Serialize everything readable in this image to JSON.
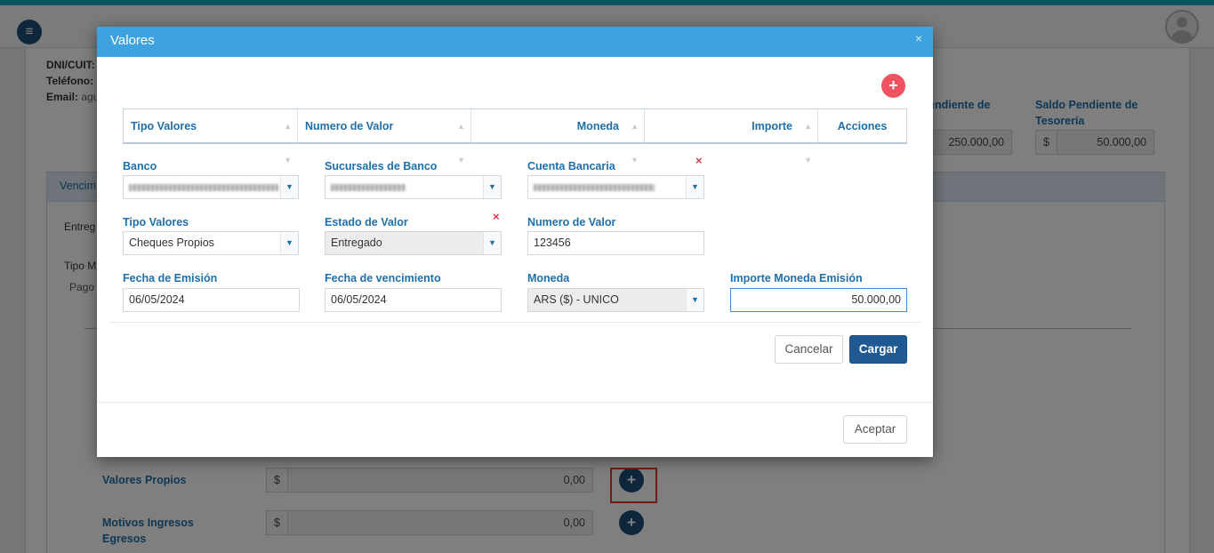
{
  "background": {
    "customer": {
      "dni_label": "DNI/CUIT:",
      "phone_label": "Teléfono:",
      "email_label": "Email:",
      "email_partial": "agu"
    },
    "balances": {
      "pending_label": "endiente de",
      "pending_value": "250.000,00",
      "treasury_label_1": "Saldo Pendiente de",
      "treasury_label_2": "Tesorería",
      "treasury_currency": "$",
      "treasury_value": "50.000,00"
    },
    "tab_partial": "Vencim",
    "entreg_partial": "Entreg",
    "tipo_partial": "Tipo M",
    "pago_partial": "Pago",
    "valores_propios": {
      "label": "Valores Propios",
      "currency": "$",
      "value": "0,00"
    },
    "motivos": {
      "label_1": "Motivos Ingresos",
      "label_2": "Egresos",
      "currency": "$",
      "value": "0,00"
    }
  },
  "modal": {
    "title": "Valores",
    "close_glyph": "×",
    "add_glyph": "+",
    "grid_columns": [
      "Tipo Valores",
      "Numero de Valor",
      "Moneda",
      "Importe",
      "Acciones"
    ],
    "fields": {
      "banco": {
        "label": "Banco"
      },
      "sucursal": {
        "label": "Sucursales de Banco"
      },
      "cuenta": {
        "label": "Cuenta Bancaria"
      },
      "tipo_valores": {
        "label": "Tipo Valores",
        "value": "Cheques Propios"
      },
      "estado": {
        "label": "Estado de Valor",
        "value": "Entregado"
      },
      "numero": {
        "label": "Numero de Valor",
        "value": "123456"
      },
      "fecha_emision": {
        "label": "Fecha de Emisión",
        "value": "06/05/2024"
      },
      "fecha_venc": {
        "label": "Fecha de vencimiento",
        "value": "06/05/2024"
      },
      "moneda": {
        "label": "Moneda",
        "value": "ARS ($) - UNICO"
      },
      "importe": {
        "label": "Importe Moneda Emisión",
        "value": "50.000,00"
      }
    },
    "buttons": {
      "cancel": "Cancelar",
      "load": "Cargar",
      "accept": "Aceptar"
    },
    "clear_glyph": "×"
  },
  "colors": {
    "modal_header": "#3da2dd",
    "primary": "#1f5a92",
    "label_blue": "#1f6fa8",
    "add_red": "#ef5260",
    "highlight_red": "#e53935"
  },
  "icons": [
    "menu-icon",
    "user-avatar-icon",
    "close-icon",
    "plus-icon",
    "sort-icon",
    "chevron-down-icon",
    "clear-icon",
    "mouse-cursor-icon"
  ]
}
